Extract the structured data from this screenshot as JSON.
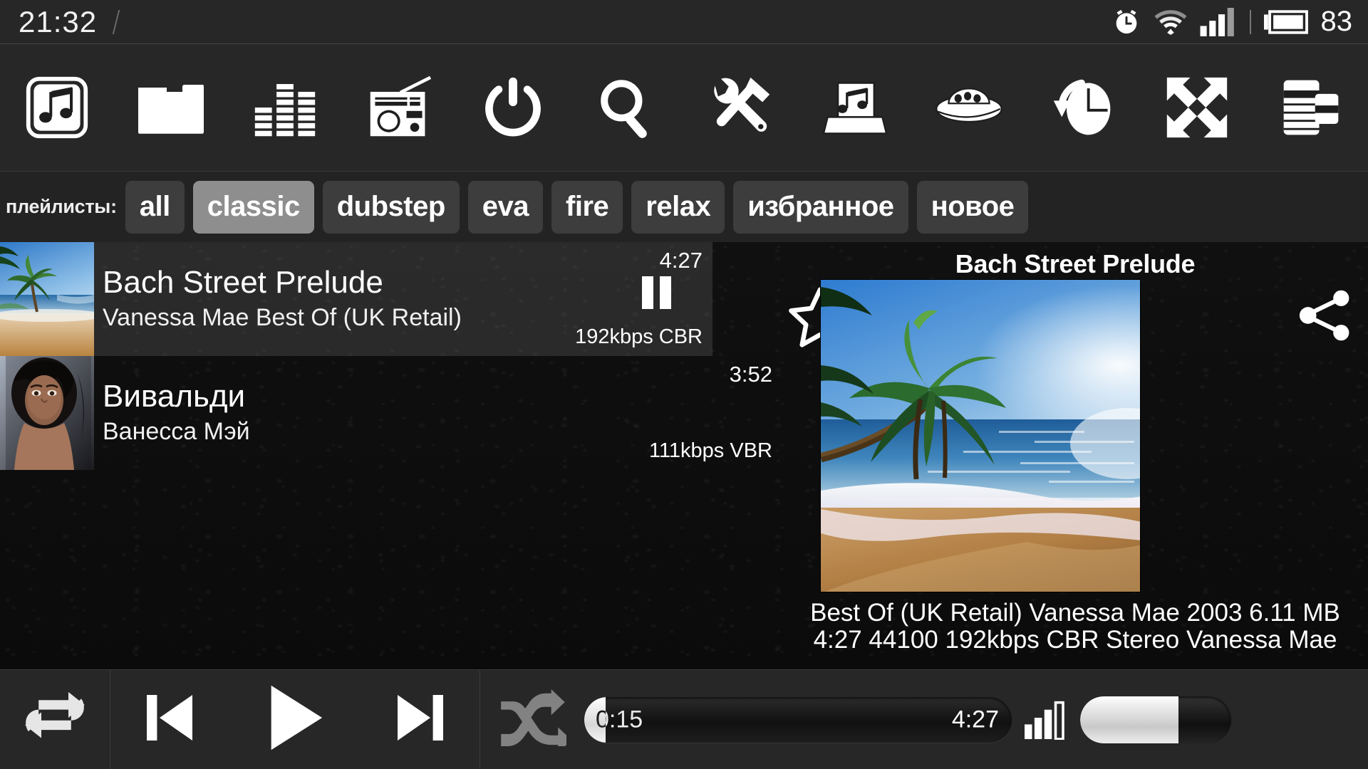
{
  "status_bar": {
    "time": "21:32",
    "battery_level": "83",
    "icons": [
      "alarm-clock-icon",
      "wifi-icon",
      "signal-bars-icon",
      "battery-icon"
    ]
  },
  "toolbar": {
    "buttons": [
      {
        "name": "library-button",
        "icon": "music-note-library-icon"
      },
      {
        "name": "folders-button",
        "icon": "folder-icon"
      },
      {
        "name": "equalizer-button",
        "icon": "equalizer-icon"
      },
      {
        "name": "radio-button",
        "icon": "radio-icon"
      },
      {
        "name": "power-button",
        "icon": "power-icon"
      },
      {
        "name": "search-button",
        "icon": "search-icon"
      },
      {
        "name": "tools-button",
        "icon": "wrench-hammer-icon"
      },
      {
        "name": "music-box-button",
        "icon": "music-box-icon"
      },
      {
        "name": "ufo-button",
        "icon": "ufo-icon"
      },
      {
        "name": "sleep-timer-button",
        "icon": "clock-rewind-icon"
      },
      {
        "name": "fullscreen-button",
        "icon": "expand-arrows-icon"
      },
      {
        "name": "playlist-button",
        "icon": "playlist-lines-icon"
      }
    ]
  },
  "playlists": {
    "label": "плейлисты:",
    "tabs": [
      {
        "label": "all",
        "selected": false
      },
      {
        "label": "classic",
        "selected": true
      },
      {
        "label": "dubstep",
        "selected": false
      },
      {
        "label": "eva",
        "selected": false
      },
      {
        "label": "fire",
        "selected": false
      },
      {
        "label": "relax",
        "selected": false
      },
      {
        "label": "избранное",
        "selected": false
      },
      {
        "label": "новое",
        "selected": false
      }
    ],
    "selected_color": "#8e8e8e",
    "tab_color": "#3d3d3d"
  },
  "tracks": [
    {
      "title": "Bach Street Prelude",
      "subtitle": "Vanessa Mae Best Of (UK Retail)",
      "duration": "4:27",
      "bitrate": "192kbps CBR",
      "playing": true,
      "artwork": "beach-palm-thumbnail"
    },
    {
      "title": "Вивальди",
      "subtitle": "Ванесса Мэй",
      "duration": "3:52",
      "bitrate": "111kbps VBR",
      "playing": false,
      "artwork": "portrait-thumbnail"
    }
  ],
  "now_playing": {
    "title": "Bach Street Prelude",
    "artwork": "beach-palm-album-art",
    "meta_line1": "Best Of (UK Retail)  Vanessa Mae  2003  6.11 MB",
    "meta_line2": "4:27  44100  192kbps CBR  Stereo  Vanessa Mae",
    "favorite_icon": "star-outline-icon",
    "share_icon": "share-icon"
  },
  "player": {
    "repeat_icon": "repeat-icon",
    "previous_icon": "skip-previous-icon",
    "play_icon": "play-icon",
    "next_icon": "skip-next-icon",
    "shuffle_icon": "shuffle-icon",
    "shuffle_active": false,
    "position": "0:15",
    "duration": "4:27",
    "progress_percent": 5,
    "volume_icon": "volume-bars-icon",
    "volume_percent": 65
  }
}
